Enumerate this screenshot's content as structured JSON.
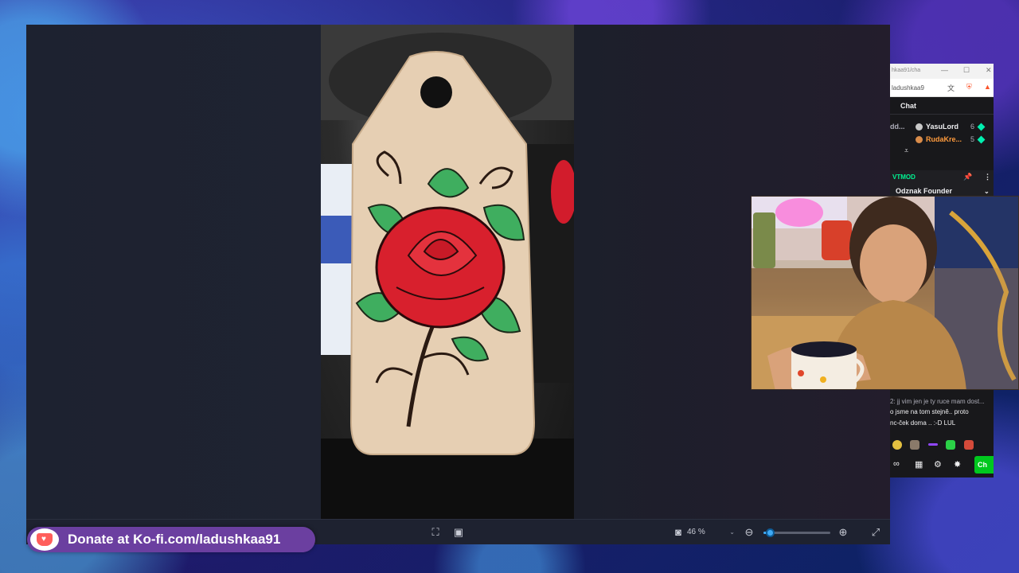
{
  "viewer": {
    "zoom_value": "46 %"
  },
  "chat": {
    "title_url": "hkaa91/cha",
    "address": "ladushkaa9",
    "header": "Chat",
    "users": [
      {
        "prefix": "dd...",
        "name": "YasuLord",
        "count": "6",
        "name_color": "#efeff1",
        "badge_color": "#c9c9c9"
      },
      {
        "prefix": "",
        "name": "RudaKre...",
        "count": "5",
        "name_color": "#ff9b3d",
        "badge_color": "#d98c4a"
      }
    ],
    "mod_label": "VTMOD",
    "founder_label": "Odznak Founder",
    "messages": [
      "2: jj vim jen je ty ruce mam dost...",
      "o jsme na tom stejně.. proto",
      "nc-ček doma .. :-D LUL"
    ],
    "chat_button": "Ch"
  },
  "donate": {
    "text": "Donate at Ko-fi.com/ladushkaa91"
  },
  "icons": {
    "screenshot": "screenshot-icon",
    "fit": "fit-screen-icon",
    "zoom_out": "zoom-out-icon",
    "zoom_in": "zoom-in-icon",
    "expand": "expand-icon"
  },
  "slider": {
    "zoom_level": 0.1
  }
}
